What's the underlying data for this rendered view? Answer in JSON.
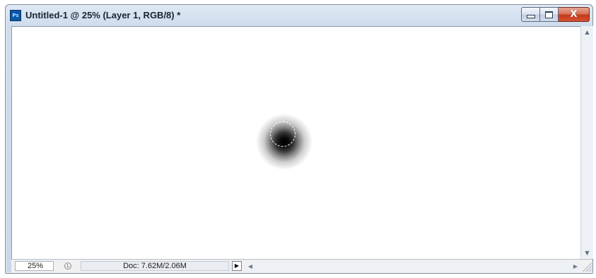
{
  "window": {
    "title": "Untitled-1 @ 25% (Layer 1, RGB/8) *",
    "app_icon_label": "Ps",
    "app_icon": "photoshop-icon",
    "caption_buttons": {
      "minimize_icon": "minimize-icon",
      "maximize_icon": "maximize-icon",
      "close_icon": "close-icon",
      "close_glyph": "X"
    }
  },
  "canvas": {
    "background": "#ffffff",
    "brush_stroke_color": "#000000"
  },
  "scrollbars": {
    "up_arrow": "▲",
    "down_arrow": "▼",
    "left_arrow": "◀",
    "right_arrow": "▶"
  },
  "statusbar": {
    "zoom": "25%",
    "doc_info": "Doc: 7.62M/2.06M",
    "menu_arrow": "▶",
    "status_icon": "clock-icon"
  },
  "colors": {
    "close_button": "#c4391b",
    "titlebar": "#cfdcec",
    "ps_icon": "#0a57a8"
  }
}
